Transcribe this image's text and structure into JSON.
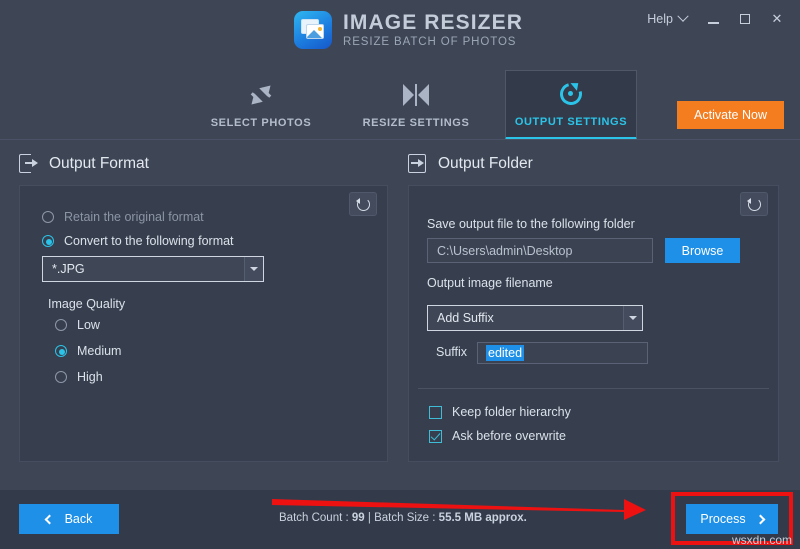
{
  "app": {
    "title": "IMAGE RESIZER",
    "subtitle": "RESIZE BATCH OF PHOTOS",
    "logo_icon": "photos-stack-icon"
  },
  "titlebar": {
    "help_label": "Help",
    "help_chevron_icon": "chevron-down-icon",
    "minimize_icon": "minimize-icon",
    "maximize_icon": "maximize-icon",
    "close_icon": "close-icon",
    "close_glyph": "✕"
  },
  "tabs": [
    {
      "label": "SELECT PHOTOS",
      "icon": "expand-arrows-icon",
      "active": false
    },
    {
      "label": "RESIZE SETTINGS",
      "icon": "compress-triangles-icon",
      "active": false
    },
    {
      "label": "OUTPUT SETTINGS",
      "icon": "refresh-circle-icon",
      "active": true
    }
  ],
  "activate": {
    "label": "Activate Now",
    "color": "#f47d20"
  },
  "output_format": {
    "section_title": "Output Format",
    "section_icon": "export-box-icon",
    "reset_icon": "reset-undo-icon",
    "options": [
      {
        "label": "Retain the original format",
        "selected": false
      },
      {
        "label": "Convert to the following format",
        "selected": true
      }
    ],
    "format_select": {
      "value": "*.JPG",
      "caret_icon": "caret-down-icon"
    },
    "quality_label": "Image Quality",
    "quality_options": [
      {
        "label": "Low",
        "selected": false
      },
      {
        "label": "Medium",
        "selected": true
      },
      {
        "label": "High",
        "selected": false
      }
    ]
  },
  "output_folder": {
    "section_title": "Output Folder",
    "section_icon": "folder-export-icon",
    "reset_icon": "reset-undo-icon",
    "save_label": "Save output file to the following folder",
    "path_value": "C:\\Users\\admin\\Desktop",
    "browse_label": "Browse",
    "filename_label": "Output image filename",
    "filename_select": {
      "value": "Add Suffix",
      "caret_icon": "caret-down-icon"
    },
    "suffix_label": "Suffix",
    "suffix_value": "edited",
    "checkboxes": [
      {
        "label": "Keep folder hierarchy",
        "checked": false
      },
      {
        "label": "Ask before overwrite",
        "checked": true
      }
    ]
  },
  "footer": {
    "back_label": "Back",
    "back_icon": "chevron-left-icon",
    "batch_count_label": "Batch Count :",
    "batch_count_value": "99",
    "separator": "|",
    "batch_size_label": "Batch Size :",
    "batch_size_value": "55.5 MB approx.",
    "process_label": "Process",
    "process_icon": "chevron-right-icon"
  },
  "annotations": {
    "arrow_icon": "red-pointer-arrow",
    "highlight_icon": "red-highlight-rectangle",
    "watermark": "wsxdn.com",
    "accent_red": "#ee1111"
  },
  "colors": {
    "accent_cyan": "#2bc4e8",
    "accent_blue": "#1e90e8",
    "accent_orange": "#f47d20",
    "background": "#3e4656",
    "panel": "#373f4e"
  }
}
